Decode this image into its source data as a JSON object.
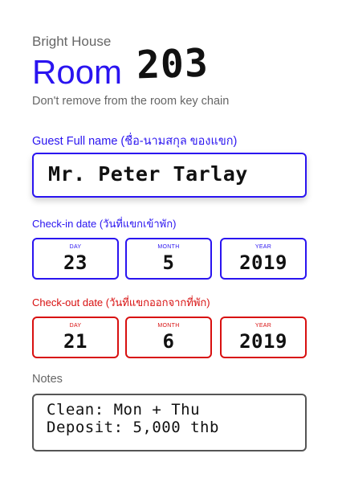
{
  "header": {
    "brand": "Bright House",
    "room_label": "Room",
    "room_number": "203",
    "subtitle": "Don't remove from the room key chain"
  },
  "guest": {
    "label": "Guest Full name  (ชื่อ-นามสกุล ของแขก)",
    "value": "Mr. Peter Tarlay"
  },
  "checkin": {
    "label": "Check-in date (วันที่แขกเข้าพัก)",
    "day_caption": "DAY",
    "month_caption": "MONTH",
    "year_caption": "YEAR",
    "day": "23",
    "month": "5",
    "year": "2019"
  },
  "checkout": {
    "label": "Check-out date (วันที่แขกออกจากที่พัก)",
    "day_caption": "DAY",
    "month_caption": "MONTH",
    "year_caption": "YEAR",
    "day": "21",
    "month": "6",
    "year": "2019"
  },
  "notes": {
    "label": "Notes",
    "line1": "Clean: Mon + Thu",
    "line2": "Deposit: 5,000 thb"
  },
  "colors": {
    "accent_blue": "#2a14f0",
    "accent_red": "#d81010",
    "muted_grey": "#666666"
  }
}
